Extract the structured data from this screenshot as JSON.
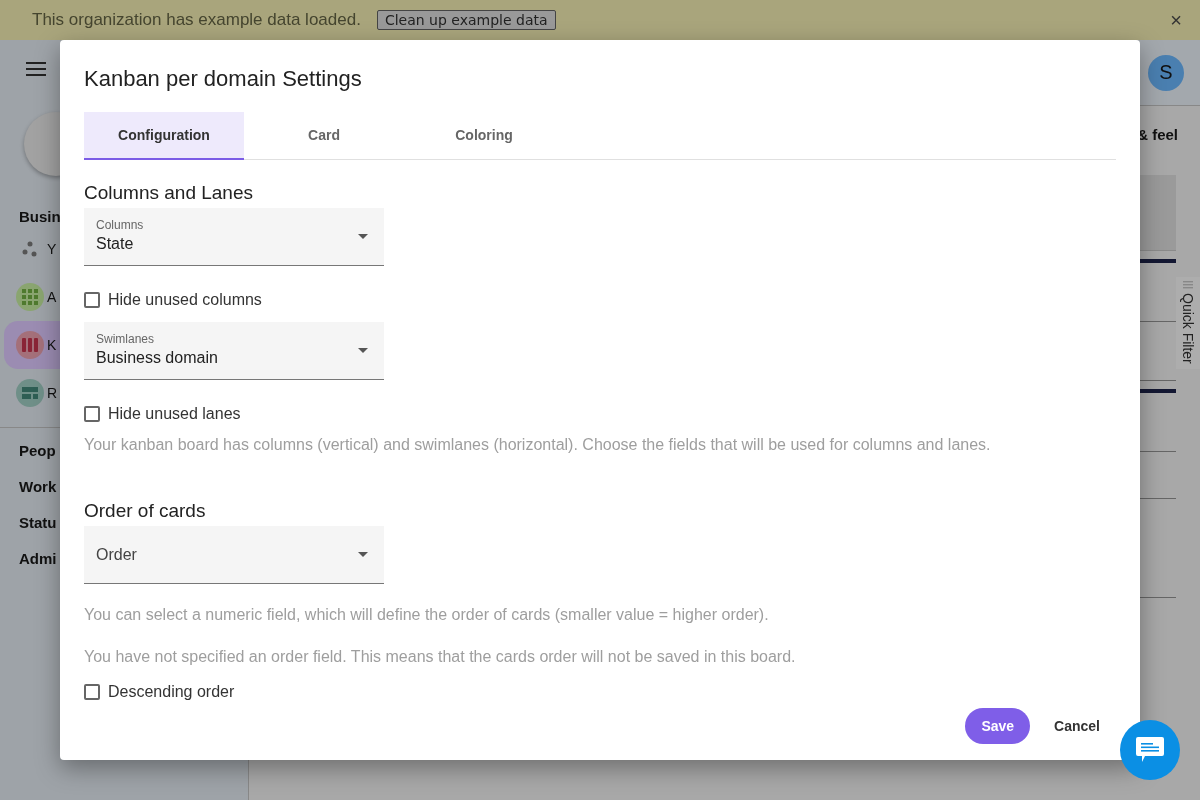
{
  "banner": {
    "message": "This organization has example data loaded.",
    "button": "Clean up example data",
    "close": "×"
  },
  "sidebar": {
    "heading": "Busin",
    "items": [
      {
        "label": "Y",
        "selected": false
      },
      {
        "label": "A",
        "selected": false,
        "color": "#8aa570"
      },
      {
        "label": "K",
        "selected": true,
        "color": "#a4707a"
      },
      {
        "label": "R",
        "selected": false,
        "color": "#6f8f88"
      }
    ],
    "sections": [
      "Peop",
      "Work",
      "Statu",
      "Admi"
    ]
  },
  "topbar": {
    "avatar": "S"
  },
  "main": {
    "heading": "& feel",
    "quick_filter": "Quick Filter"
  },
  "dialog": {
    "title": "Kanban per domain Settings",
    "tabs": [
      {
        "label": "Configuration",
        "selected": true
      },
      {
        "label": "Card",
        "selected": false
      },
      {
        "label": "Coloring",
        "selected": false
      }
    ],
    "content": [
      {
        "kind": "heading",
        "text": "Columns and Lanes"
      },
      {
        "kind": "select",
        "label": "Columns",
        "value": "State"
      },
      {
        "kind": "checkbox",
        "label": "Hide unused columns",
        "checked": false
      },
      {
        "kind": "select",
        "label": "Swimlanes",
        "value": "Business domain"
      },
      {
        "kind": "checkbox",
        "label": "Hide unused lanes",
        "checked": false
      },
      {
        "kind": "hint",
        "text": "Your kanban board has columns (vertical) and swimlanes (horizontal). Choose the fields that will be used for columns and lanes."
      },
      {
        "kind": "heading",
        "text": "Order of cards"
      },
      {
        "kind": "select",
        "placeholder": "Order"
      },
      {
        "kind": "hint",
        "text": "You can select a numeric field, which will define the order of cards (smaller value = higher order)."
      },
      {
        "kind": "hint",
        "text": "You have not specified an order field. This means that the cards order will not be saved in this board."
      },
      {
        "kind": "checkbox",
        "label": "Descending order",
        "checked": false
      }
    ],
    "buttons": [
      {
        "label": "Save",
        "kind": "primary"
      },
      {
        "label": "Cancel",
        "kind": "text"
      }
    ]
  }
}
